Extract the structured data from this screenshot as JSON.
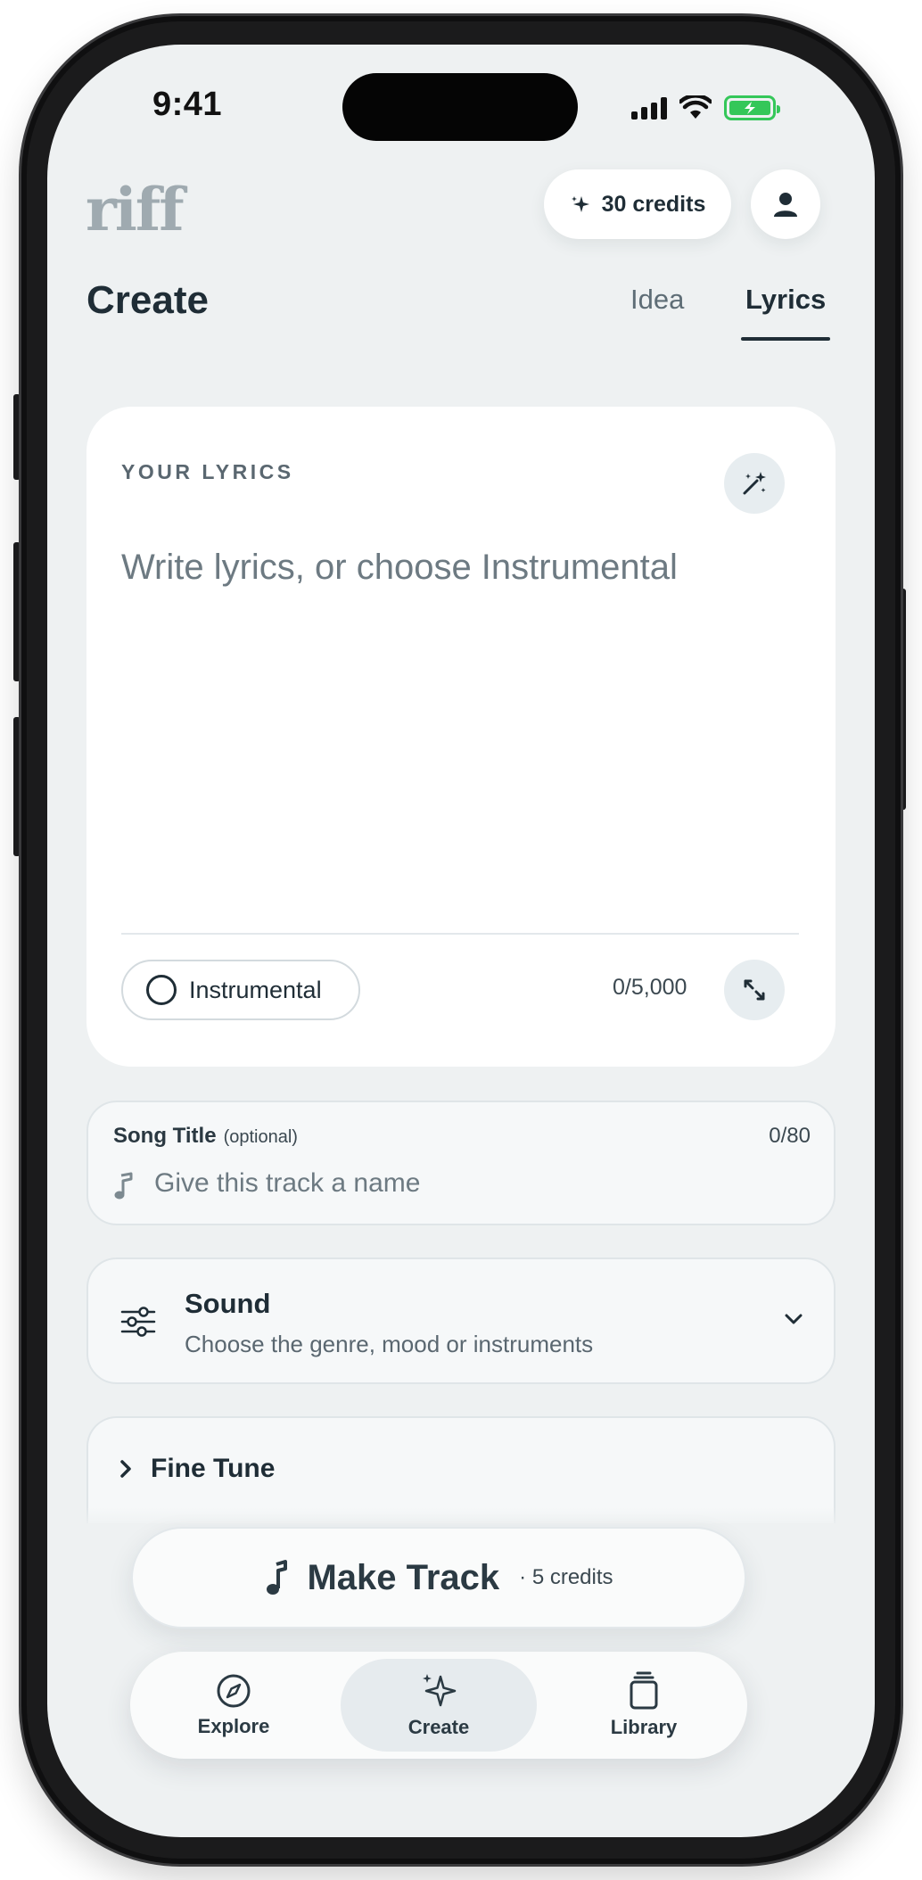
{
  "status_bar": {
    "time": "9:41"
  },
  "header": {
    "logo": "riff",
    "credits_label": "30 credits",
    "avatar_icon": "user-icon"
  },
  "page": {
    "title": "Create",
    "tabs": [
      {
        "label": "Idea",
        "active": false
      },
      {
        "label": "Lyrics",
        "active": true
      }
    ]
  },
  "lyrics": {
    "label": "YOUR LYRICS",
    "placeholder": "Write lyrics, or choose Instrumental",
    "instrumental_label": "Instrumental",
    "char_count": "0/5,000",
    "magic_icon": "magic-wand-icon",
    "expand_icon": "expand-icon"
  },
  "song_title": {
    "label": "Song Title",
    "optional": "(optional)",
    "count": "0/80",
    "placeholder": "Give this track a name"
  },
  "sound": {
    "title": "Sound",
    "subtitle": "Choose the genre, mood or instruments"
  },
  "fine_tune": {
    "title": "Fine Tune"
  },
  "make_track": {
    "label": "Make Track",
    "cost": "· 5 credits"
  },
  "nav": {
    "items": [
      {
        "label": "Explore",
        "icon": "compass-icon",
        "active": false
      },
      {
        "label": "Create",
        "icon": "sparkle-icon",
        "active": true
      },
      {
        "label": "Library",
        "icon": "library-icon",
        "active": false
      }
    ]
  },
  "colors": {
    "screen_bg": "#eef1f2",
    "text_primary": "#1f2d36",
    "text_muted": "#6d7a82",
    "battery": "#34c759"
  }
}
